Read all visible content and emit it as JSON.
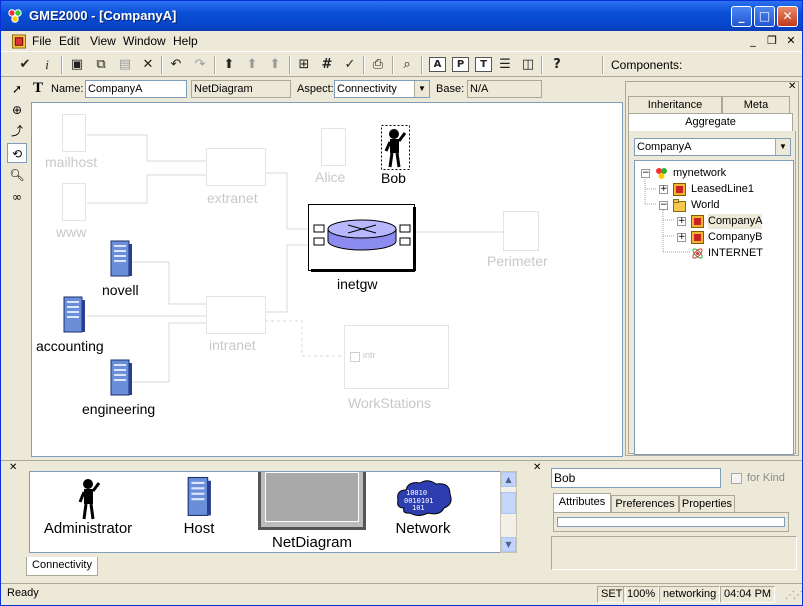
{
  "app": {
    "title": "GME2000 - [CompanyA]"
  },
  "menu": [
    "File",
    "Edit",
    "View",
    "Window",
    "Help"
  ],
  "toolbar": {
    "components_label": "Components:"
  },
  "props": {
    "name_label": "Name:",
    "name_value": "CompanyA",
    "kind_value": "NetDiagram",
    "aspect_label": "Aspect:",
    "aspect_value": "Connectivity",
    "base_label": "Base:",
    "base_value": "N/A"
  },
  "canvas": {
    "nodes": {
      "mailhost": "mailhost",
      "www": "www",
      "extranet": "extranet",
      "alice": "Alice",
      "bob": "Bob",
      "inetgw": "inetgw",
      "perimeter": "Perimeter",
      "novell": "novell",
      "accounting": "accounting",
      "intranet": "intranet",
      "engineering": "engineering",
      "workstations": "WorkStations",
      "intr_port": "intr"
    }
  },
  "browser": {
    "tabs": [
      "Inheritance",
      "Meta"
    ],
    "active_tab": "Aggregate",
    "selector_value": "CompanyA",
    "tree": [
      {
        "label": "mynetwork",
        "level": 0,
        "expander": "−"
      },
      {
        "label": "LeasedLine1",
        "level": 1,
        "expander": "+"
      },
      {
        "label": "World",
        "level": 1,
        "expander": "−"
      },
      {
        "label": "CompanyA",
        "level": 2,
        "expander": "+"
      },
      {
        "label": "CompanyB",
        "level": 2,
        "expander": "+"
      },
      {
        "label": "INTERNET",
        "level": 2,
        "expander": ""
      }
    ]
  },
  "partbrowser": {
    "items": [
      "Administrator",
      "Host",
      "NetDiagram",
      "Network"
    ],
    "tab": "Connectivity"
  },
  "attributes": {
    "name_value": "Bob",
    "for_kind_label": "for Kind",
    "tabs": [
      "Attributes",
      "Preferences",
      "Properties"
    ]
  },
  "status": {
    "ready": "Ready",
    "set": "SET",
    "zoom": "100%",
    "paradigm": "networking",
    "time": "04:04 PM"
  }
}
